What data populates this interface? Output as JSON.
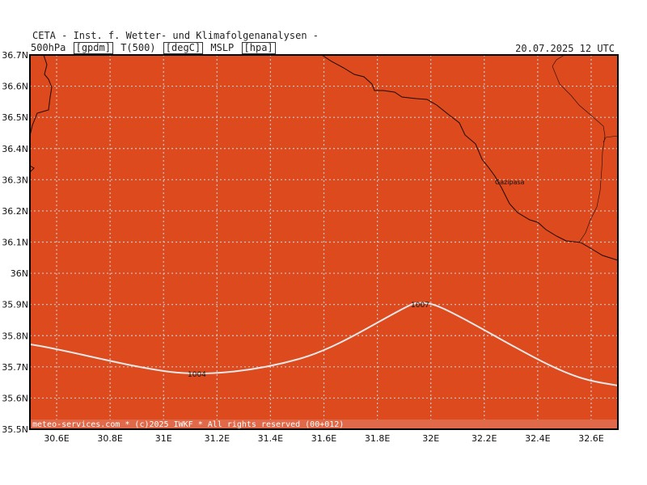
{
  "header": {
    "org": "CETA - Inst. f. Wetter- und Klimafolgenanalysen -",
    "legend": [
      "500hPa",
      "[gpdm]",
      "T(500)",
      "[degC]",
      "MSLP",
      "[hpa]"
    ],
    "datetime": "20.07.2025 12 UTC"
  },
  "map": {
    "background_color": "#dc4a1e",
    "grid": true,
    "lat_range": [
      35.5,
      36.7
    ],
    "lon_range": [
      30.5,
      32.7
    ],
    "lat_ticks": [
      "36.7N",
      "36.6N",
      "36.5N",
      "36.4N",
      "36.3N",
      "36.2N",
      "36.1N",
      "36N",
      "35.9N",
      "35.8N",
      "35.7N",
      "35.6N",
      "35.5N"
    ],
    "lon_ticks": [
      "30.6E",
      "30.8E",
      "31E",
      "31.2E",
      "31.4E",
      "31.6E",
      "31.8E",
      "32E",
      "32.2E",
      "32.4E",
      "32.6E"
    ],
    "place_label": "Gazipasa",
    "isobar_labels": [
      "1004",
      "1007"
    ],
    "isobar_color": "#e8e8e8",
    "footer": "meteo-services.com * (c)2025 IWKF * All rights reserved (00+012)"
  }
}
